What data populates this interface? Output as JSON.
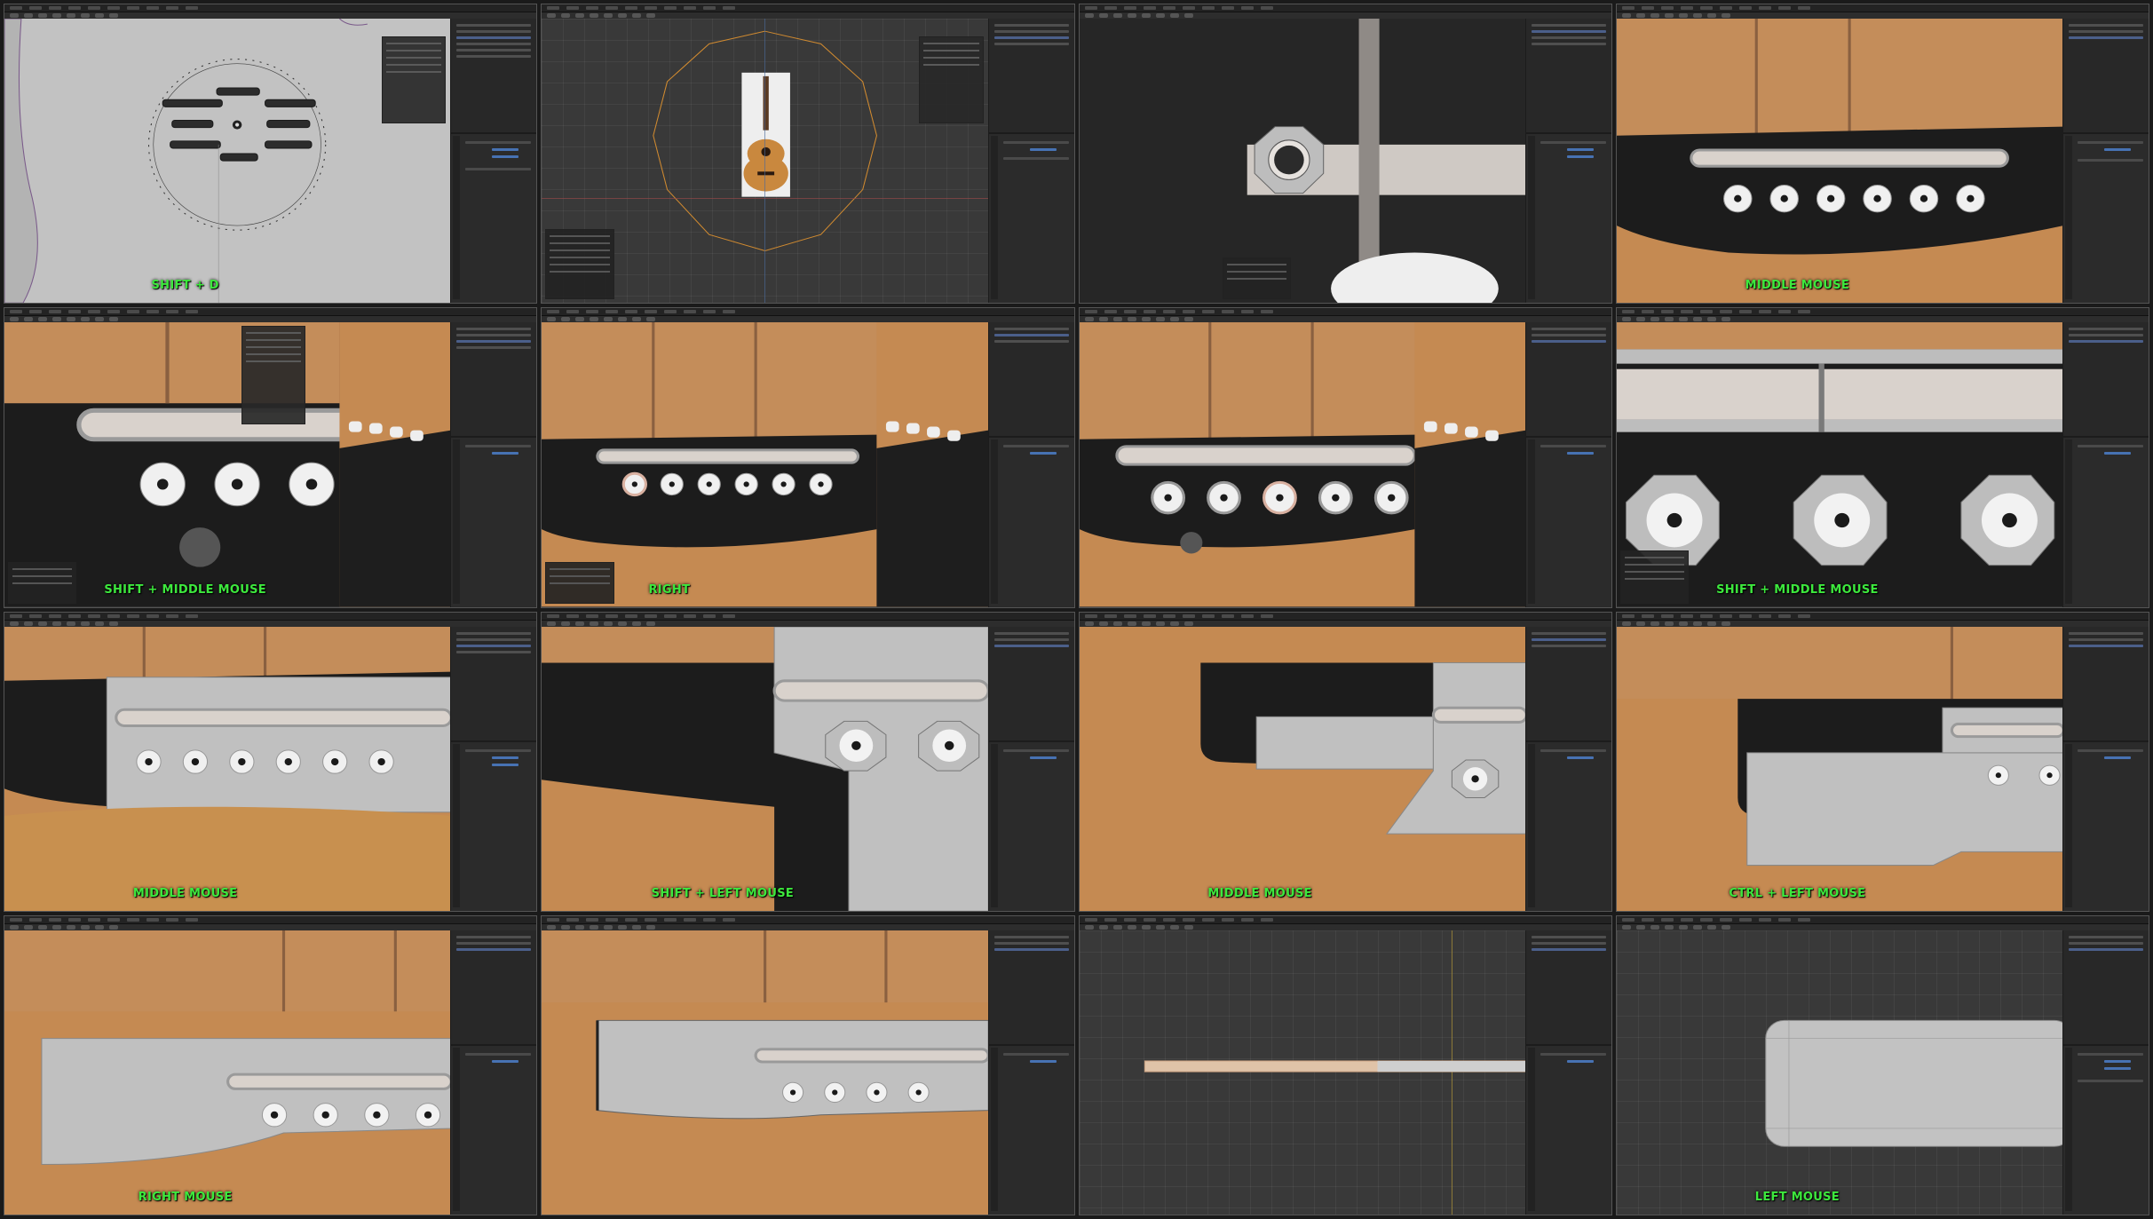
{
  "panels": [
    {
      "id": 1,
      "hint": "SHIFT + D"
    },
    {
      "id": 2,
      "hint": ""
    },
    {
      "id": 3,
      "hint": ""
    },
    {
      "id": 4,
      "hint": "MIDDLE MOUSE"
    },
    {
      "id": 5,
      "hint": "SHIFT + MIDDLE MOUSE"
    },
    {
      "id": 6,
      "hint": "RIGHT"
    },
    {
      "id": 7,
      "hint": ""
    },
    {
      "id": 8,
      "hint": "SHIFT + MIDDLE MOUSE"
    },
    {
      "id": 9,
      "hint": "MIDDLE MOUSE"
    },
    {
      "id": 10,
      "hint": "SHIFT + LEFT MOUSE"
    },
    {
      "id": 11,
      "hint": "MIDDLE MOUSE"
    },
    {
      "id": 12,
      "hint": "CTRL + LEFT MOUSE"
    },
    {
      "id": 13,
      "hint": "RIGHT MOUSE"
    },
    {
      "id": 14,
      "hint": ""
    },
    {
      "id": 15,
      "hint": ""
    },
    {
      "id": 16,
      "hint": "LEFT MOUSE"
    }
  ],
  "colors": {
    "hint": "#3de83d",
    "wood": "#c58a52",
    "dark": "#1c1c1c",
    "mesh": "#b8b8b8",
    "selection": "#4772b3"
  }
}
